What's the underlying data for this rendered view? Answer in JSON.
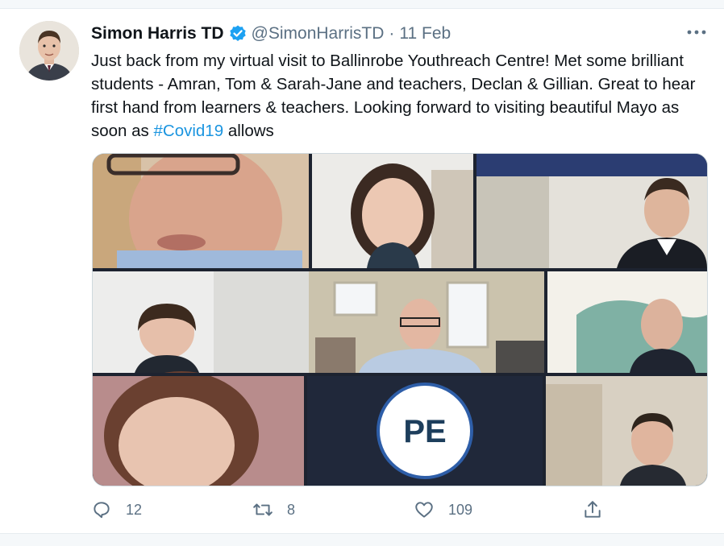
{
  "tweet": {
    "author_name": "Simon Harris TD",
    "handle": "@SimonHarrisTD",
    "separator": "·",
    "date": "11 Feb",
    "text_before": "Just back from my virtual visit to Ballinrobe Youthreach Centre! Met some brilliant students - Amran, Tom & Sarah-Jane and teachers, Declan & Gillian. Great to hear first hand from learners & teachers. Looking forward to visiting beautiful Mayo as soon as ",
    "hashtag": "#Covid19",
    "text_after": " allows",
    "media": {
      "tile_initials": "PE"
    },
    "actions": {
      "reply_count": "12",
      "retweet_count": "8",
      "like_count": "109"
    }
  },
  "icons": {
    "verified": "verified-badge-icon",
    "more": "more-dots-icon",
    "reply": "reply-icon",
    "retweet": "retweet-icon",
    "like": "heart-icon",
    "share": "share-icon"
  },
  "colors": {
    "text_primary": "#0f1419",
    "text_secondary": "#5b7083",
    "accent": "#1da1f2",
    "hashtag": "#1b95e0"
  }
}
